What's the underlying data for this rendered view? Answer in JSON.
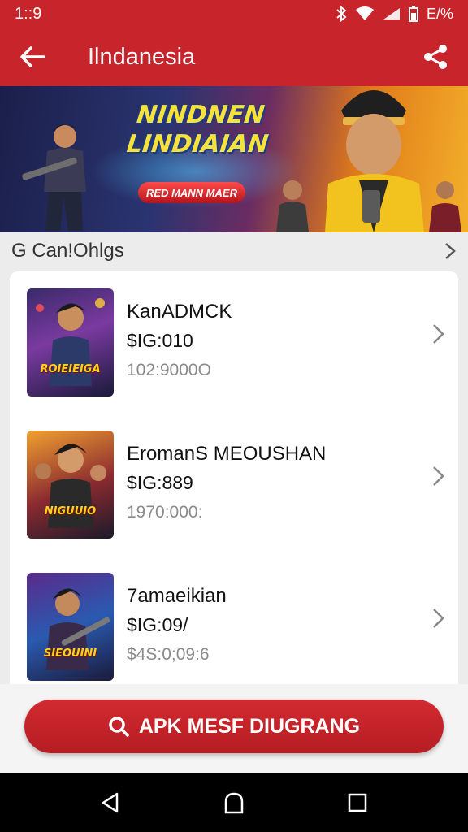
{
  "status_bar": {
    "time": "1::9",
    "battery_text": "E/%"
  },
  "app_bar": {
    "title": "Ilndanesia",
    "icons": {
      "back": "arrow-left-icon",
      "share": "share-icon"
    }
  },
  "banner": {
    "title_line1": "NINDNEN",
    "title_line2": "LINDIAIAN",
    "pill": "RED MANN MAER"
  },
  "section": {
    "title": "G Can!Ohlgs"
  },
  "list": [
    {
      "name": "KanADMCK",
      "price": "$IG:010",
      "meta": "102:9000O",
      "thumb_label": "ROIEIEIGA"
    },
    {
      "name": "EromanS MEOUSHAN",
      "price": "$IG:889",
      "meta": "1970:000:",
      "thumb_label": "NIGUUIO"
    },
    {
      "name": "7amaeikian",
      "price": "$IG:09/",
      "meta": "$4S:0;09:6",
      "thumb_label": "SIEOUINI"
    }
  ],
  "action": {
    "apk_button_label": "APK MESF DIUGRANG"
  },
  "colors": {
    "brand_red": "#c8242b",
    "background": "#ececec",
    "card": "#ffffff"
  }
}
